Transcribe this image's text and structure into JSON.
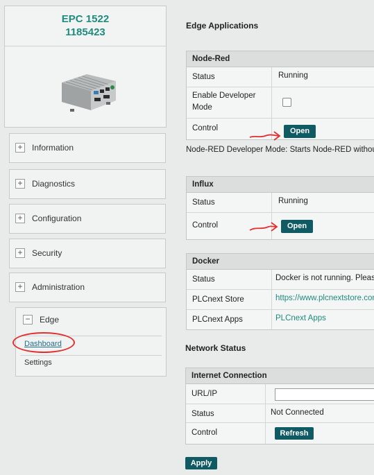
{
  "device": {
    "model": "EPC 1522",
    "serial": "1185423"
  },
  "sidebar": {
    "items": [
      {
        "label": "Information"
      },
      {
        "label": "Diagnostics"
      },
      {
        "label": "Configuration"
      },
      {
        "label": "Security"
      },
      {
        "label": "Administration"
      }
    ],
    "edge": {
      "label": "Edge",
      "subitems": [
        {
          "label": "Dashboard"
        },
        {
          "label": "Settings"
        }
      ]
    }
  },
  "edge_apps": {
    "heading": "Edge Applications",
    "nodered": {
      "title": "Node-Red",
      "status_label": "Status",
      "status_value": "Running",
      "dev_label": "Enable Developer Mode",
      "control_label": "Control",
      "open_button": "Open",
      "note": "Node-RED Developer Mode: Starts Node-RED withou"
    },
    "influx": {
      "title": "Influx",
      "status_label": "Status",
      "status_value": "Running",
      "control_label": "Control",
      "open_button": "Open"
    },
    "docker": {
      "title": "Docker",
      "status_label": "Status",
      "status_value": "Docker is not running. Please",
      "store_label": "PLCnext Store",
      "store_value": "https://www.plcnextstore.com/",
      "apps_label": "PLCnext Apps",
      "apps_value": "PLCnext Apps"
    }
  },
  "network": {
    "heading": "Network Status",
    "internet": {
      "title": "Internet Connection",
      "url_label": "URL/IP",
      "url_value": "",
      "status_label": "Status",
      "status_value": "Not Connected",
      "control_label": "Control",
      "refresh_button": "Refresh"
    }
  },
  "apply_button": "Apply",
  "colors": {
    "accent": "#1f8a7e",
    "button": "#0f5a63",
    "annotation": "#e03030"
  }
}
